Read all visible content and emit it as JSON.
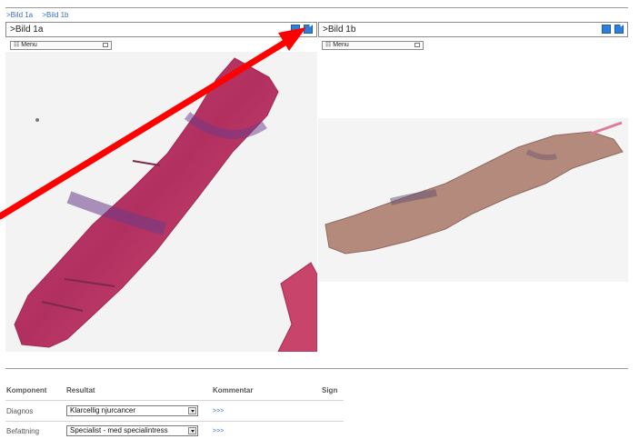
{
  "breadcrumbs": [
    ">Bild 1a",
    ">Bild 1b"
  ],
  "panels": [
    {
      "title": ">Bild 1a",
      "menu_label": "Menu"
    },
    {
      "title": ">Bild 1b",
      "menu_label": "Menu"
    }
  ],
  "form": {
    "headers": {
      "component": "Komponent",
      "result": "Resultat",
      "comment": "Kommentar",
      "sign": "Sign"
    },
    "rows": [
      {
        "label": "Diagnos",
        "value": "Klarcellig njurcancer",
        "more": ">>>"
      },
      {
        "label": "Befattning",
        "value": "Specialist - med specialintress",
        "more": ">>>"
      }
    ]
  },
  "colors": {
    "link": "#3a6fc6",
    "icon_blue": "#2f7fd8",
    "arrow_red": "#ff0000",
    "tissue_a": "#c23a5f",
    "tissue_b": "#b48a7c"
  }
}
